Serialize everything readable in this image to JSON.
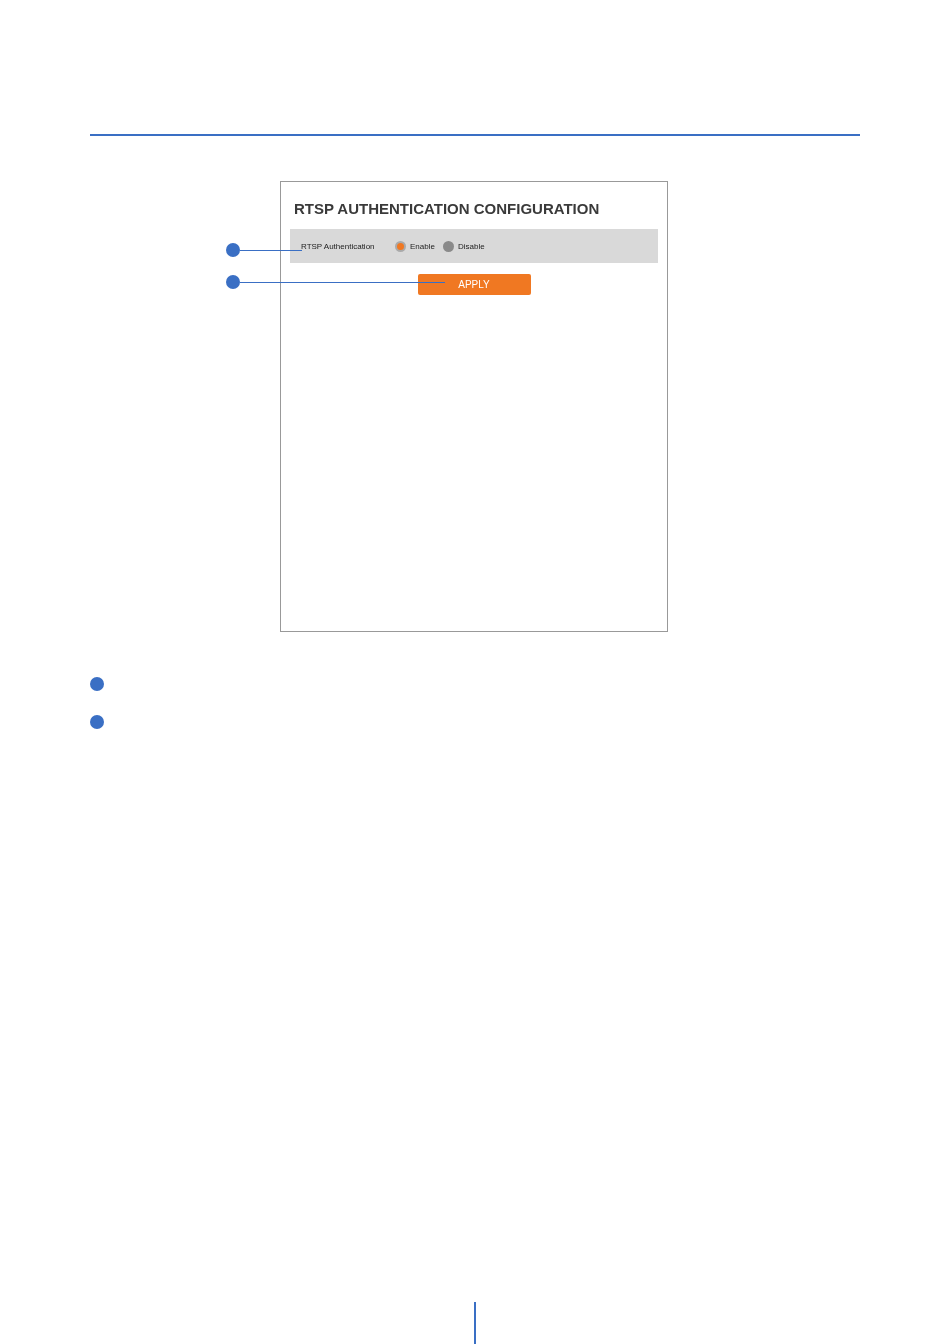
{
  "panel": {
    "title": "RTSP AUTHENTICATION CONFIGURATION",
    "setting": {
      "label": "RTSP Authentication",
      "options": [
        {
          "label": "Enable",
          "selected": true
        },
        {
          "label": "Disable",
          "selected": false
        }
      ]
    },
    "apply_button": "APPLY"
  }
}
